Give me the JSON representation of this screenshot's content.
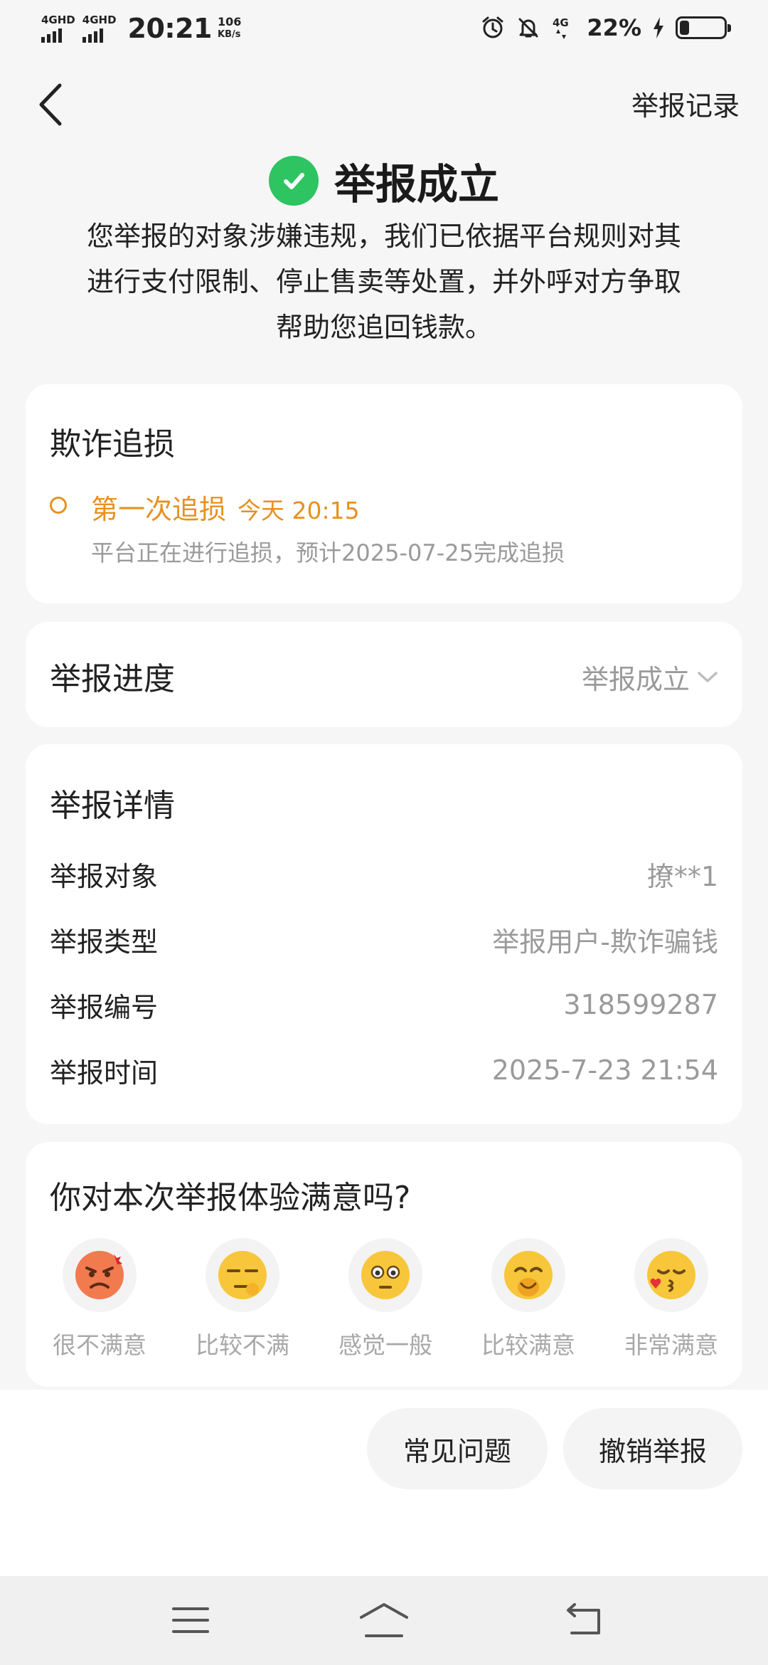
{
  "status_bar": {
    "signal1": "4GHD",
    "signal2": "4GHD",
    "time": "20:21",
    "speed_value": "106",
    "speed_unit": "KB/s",
    "network": "4G",
    "battery_pct": "22%",
    "battery_level": 0.22,
    "icons": [
      "alarm-icon",
      "bell-off-icon",
      "network-4g-icon",
      "charging-icon",
      "battery-icon"
    ]
  },
  "nav": {
    "back_icon": "chevron-left-icon",
    "right_link": "举报记录"
  },
  "header": {
    "title": "举报成立",
    "description": "您举报的对象涉嫌违规，我们已依据平台规则对其进行支付限制、停止售卖等处置，并外呼对方争取帮助您追回钱款。",
    "check_color": "#2dc461"
  },
  "fraud_card": {
    "title": "欺诈追损",
    "step": "第一次追损",
    "step_time": "今天 20:15",
    "step_desc": "平台正在进行追损，预计2025-07-25完成追损",
    "accent_color": "#e8901f"
  },
  "progress_card": {
    "title": "举报进度",
    "value": "举报成立"
  },
  "detail_card": {
    "title": "举报详情",
    "rows": [
      {
        "key": "举报对象",
        "value": "撩**1"
      },
      {
        "key": "举报类型",
        "value": "举报用户-欺诈骗钱"
      },
      {
        "key": "举报编号",
        "value": "318599287"
      },
      {
        "key": "举报时间",
        "value": "2025-7-23 21:54"
      }
    ]
  },
  "survey_card": {
    "title": "你对本次举报体验满意吗?",
    "options": [
      {
        "label": "很不满意",
        "icon": "angry-face-icon"
      },
      {
        "label": "比较不满",
        "icon": "displeased-face-icon"
      },
      {
        "label": "感觉一般",
        "icon": "neutral-face-icon"
      },
      {
        "label": "比较满意",
        "icon": "happy-face-icon"
      },
      {
        "label": "非常满意",
        "icon": "kissing-face-icon"
      }
    ]
  },
  "actions": {
    "faq": "常见问题",
    "cancel": "撤销举报"
  },
  "system_nav": [
    "menu-icon",
    "home-icon",
    "back-icon"
  ]
}
